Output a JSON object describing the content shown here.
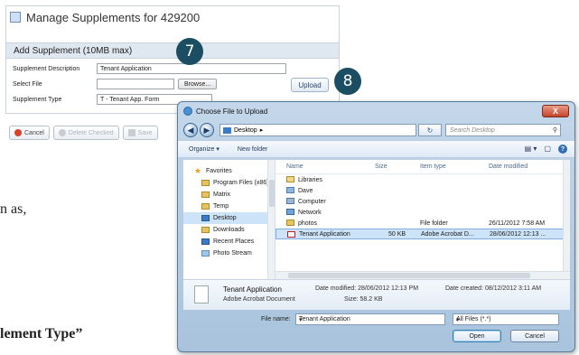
{
  "manage": {
    "title": "Manage Supplements for 429200",
    "section": "Add Supplement (10MB max)",
    "desc_label": "Supplement Description",
    "desc_value": "Tenant Application",
    "file_label": "Select File",
    "file_value": "",
    "browse": "Browse...",
    "type_label": "Supplement Type",
    "type_value": "T - Tenant App. Form",
    "upload": "Upload",
    "cancel": "Cancel",
    "delete_checked": "Delete Checked",
    "save": "Save"
  },
  "steps": {
    "seven": "7",
    "eight": "8"
  },
  "background_text": {
    "line1": "n as,",
    "line2": "lement Type”"
  },
  "dialog": {
    "title": "Choose File to Upload",
    "close": "X",
    "address": "Desktop",
    "address_arrow": "▸",
    "search_placeholder": "Search Desktop",
    "organize": "Organize ▾",
    "new_folder": "New folder",
    "columns": {
      "name": "Name",
      "size": "Size",
      "type": "Item type",
      "date": "Date modified"
    },
    "nav": [
      {
        "label": "Favorites"
      },
      {
        "label": "Program Files (x86)"
      },
      {
        "label": "Matrix"
      },
      {
        "label": "Temp"
      },
      {
        "label": "Desktop"
      },
      {
        "label": "Downloads"
      },
      {
        "label": "Recent Places"
      },
      {
        "label": "Photo Stream"
      }
    ],
    "files": [
      {
        "name": "Libraries",
        "size": "",
        "type": "",
        "date": ""
      },
      {
        "name": "Dave",
        "size": "",
        "type": "",
        "date": ""
      },
      {
        "name": "Computer",
        "size": "",
        "type": "",
        "date": ""
      },
      {
        "name": "Network",
        "size": "",
        "type": "",
        "date": ""
      },
      {
        "name": "photos",
        "size": "",
        "type": "File folder",
        "date": "26/11/2012 7:58 AM"
      },
      {
        "name": "Tenant Application",
        "size": "50 KB",
        "type": "Adobe Acrobat D...",
        "date": "28/06/2012 12:13 ..."
      }
    ],
    "details": {
      "name": "Tenant Application",
      "kind": "Adobe Acrobat Document",
      "modified": "Date modified: 28/06/2012 12:13 PM",
      "size": "Size: 58.2 KB",
      "created": "Date created: 08/12/2012 3:11 AM"
    },
    "file_name_label": "File name:",
    "file_name_value": "Tenant Application",
    "file_type": "All Files (*.*)",
    "open": "Open",
    "cancel": "Cancel"
  }
}
